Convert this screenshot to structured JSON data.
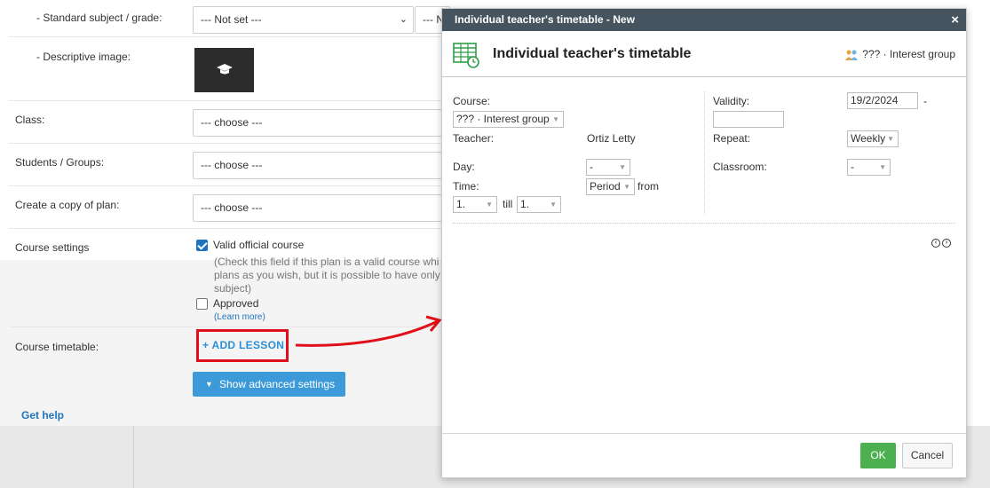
{
  "form": {
    "standard_subject_label": "- Standard subject / grade:",
    "standard_subject_value": "--- Not set ---",
    "standard_subject_second_value": "--- N",
    "descriptive_image_label": "- Descriptive image:",
    "class_label": "Class:",
    "class_value": "--- choose ---",
    "students_label": "Students / Groups:",
    "students_value": "--- choose ---",
    "copy_label": "Create a copy of plan:",
    "copy_value": "--- choose ---",
    "course_settings_label": "Course settings",
    "valid_official_label": "Valid official course",
    "valid_official_help": "(Check this field if this plan is a valid course whi plans as you wish, but it is possible to have only subject)",
    "approved_label": "Approved",
    "learn_more": "(Learn more)",
    "course_timetable_label": "Course timetable:",
    "add_lesson": "+ ADD LESSON",
    "advanced_settings": "Show advanced settings",
    "get_help": "Get help"
  },
  "dialog": {
    "title": "Individual teacher's timetable - New",
    "close": "×",
    "heading": "Individual teacher's timetable",
    "group_text": "??? · Interest group",
    "course_label": "Course:",
    "course_value": "??? · Interest group",
    "teacher_label": "Teacher:",
    "teacher_value": "Ortiz Letty",
    "day_label": "Day:",
    "day_value": "-",
    "time_label": "Time:",
    "time_mode_value": "Period",
    "from_label": "from",
    "time_from_value": "1.",
    "till_label": "till",
    "time_till_value": "1.",
    "validity_label": "Validity:",
    "validity_start": "19/2/2024",
    "validity_dash": "-",
    "validity_end": "",
    "repeat_label": "Repeat:",
    "repeat_value": "Weekly",
    "classroom_label": "Classroom:",
    "classroom_value": "-",
    "ok": "OK",
    "cancel": "Cancel"
  },
  "colors": {
    "highlight": "#e0101a",
    "link": "#1e73be",
    "ok_button": "#4caf50",
    "title_bar": "#45545e"
  }
}
